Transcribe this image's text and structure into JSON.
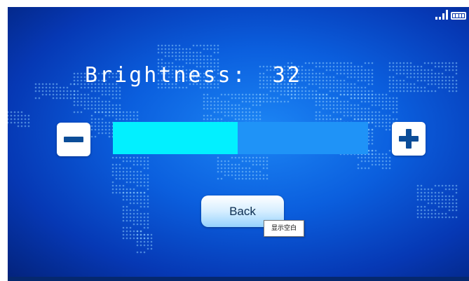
{
  "status_bar": {
    "signal_icon": "signal-bars-icon",
    "battery_icon": "battery-icon"
  },
  "brightness": {
    "label": "Brightness:",
    "value": "32",
    "level_fraction": 0.49
  },
  "controls": {
    "decrease_icon": "minus-icon",
    "increase_icon": "plus-icon"
  },
  "back_button": {
    "label": "Back"
  },
  "tooltip": {
    "text": "显示空白"
  },
  "colors": {
    "background_center": "#1c86f5",
    "background_edge": "#03227a",
    "slider_fill": "#02f0ff",
    "slider_track": "#1f93f7",
    "icon_color": "#0c4d98",
    "text": "#ffffff"
  }
}
